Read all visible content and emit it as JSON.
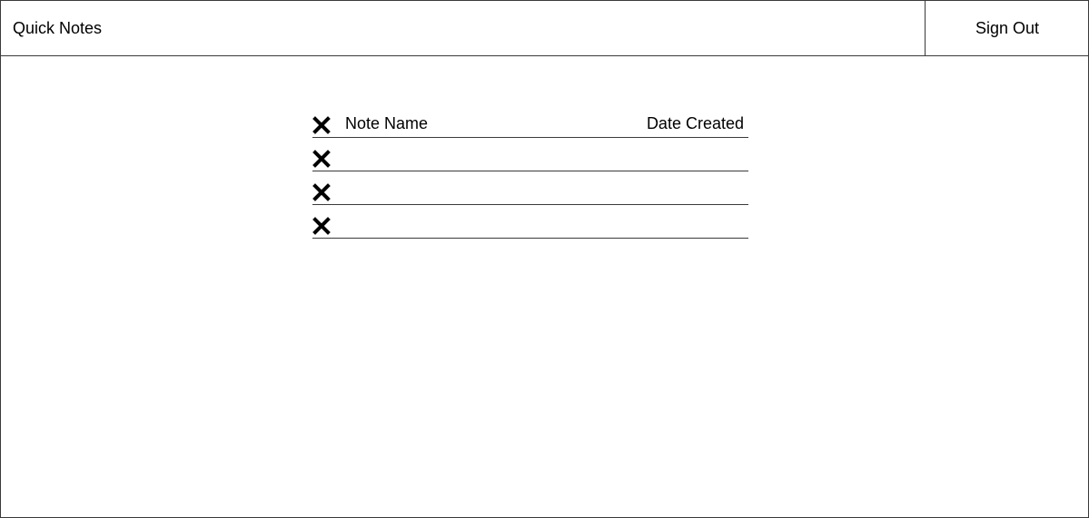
{
  "app": {
    "title": "Quick Notes",
    "sign_out_label": "Sign Out"
  },
  "notes_table": {
    "columns": {
      "name": "Note Name",
      "date": "Date Created"
    },
    "rows": [
      {
        "name": "",
        "date": ""
      },
      {
        "name": "",
        "date": ""
      },
      {
        "name": "",
        "date": ""
      }
    ]
  },
  "icons": {
    "delete": "close-icon"
  },
  "colors": {
    "border": "#3a3a3a",
    "text": "#000000",
    "background": "#ffffff"
  }
}
